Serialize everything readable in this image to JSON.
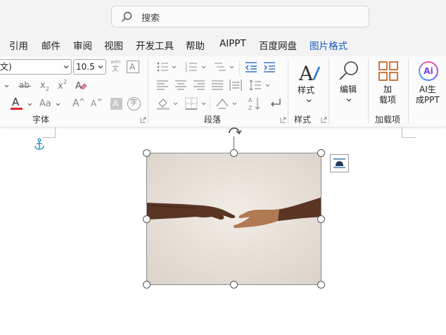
{
  "search": {
    "placeholder": "搜索",
    "icon": "search-icon"
  },
  "menu": {
    "items": [
      "引用",
      "邮件",
      "审阅",
      "视图",
      "开发工具",
      "帮助",
      "AIPPT",
      "百度网盘",
      "图片格式"
    ],
    "active_index": 8,
    "active_color": "#185abd"
  },
  "ribbon": {
    "font": {
      "name_value": "文)",
      "size_value": "10.5",
      "phonetic_label": "wén",
      "phonetic_char": "文",
      "char_border": "A",
      "clear_char": "ab",
      "subscript": "x",
      "subscript_mark": "2",
      "superscript": "x",
      "superscript_mark": "2",
      "font_color_glyph": "A",
      "font_color": "#e0242b",
      "change_case": "Aa",
      "grow_font": "A",
      "shrink_font": "A",
      "shading_char": "A",
      "enclose_char": "字",
      "group_label": "字体"
    },
    "paragraph": {
      "group_label": "段落"
    },
    "styles": {
      "button_label": "样式",
      "group_label": "样式"
    },
    "editing": {
      "button_label": "编辑"
    },
    "addins": {
      "button_label_line1": "加",
      "button_label_line2": "载项",
      "group_label": "加载项"
    },
    "ai": {
      "button_label_line1": "AI生",
      "button_label_line2": "成PPT",
      "icon_text": "Ai"
    }
  },
  "colors": {
    "accent": "#185abd",
    "addin_orange": "#c55a11",
    "highlight_yellow": "#ffd400"
  }
}
